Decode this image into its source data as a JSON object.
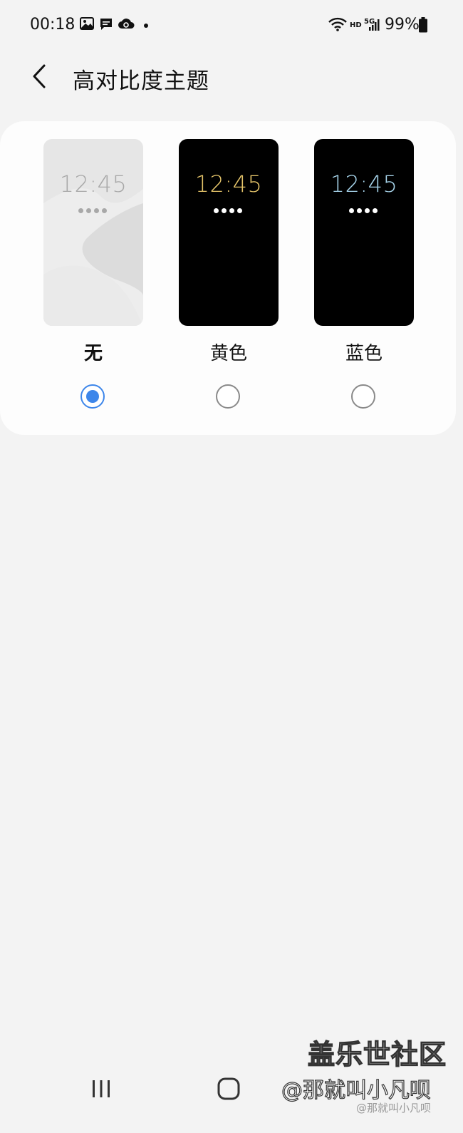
{
  "status_bar": {
    "time": "00:18",
    "battery": "99%",
    "hd_label": "HD",
    "network_label": "5G",
    "left_icons": [
      "image-icon",
      "message-icon",
      "cloud-sync-icon",
      "dot-icon"
    ],
    "right_icons": [
      "wifi-icon",
      "signal-icon",
      "battery-icon"
    ]
  },
  "header": {
    "title": "高对比度主题",
    "back_icon": "chevron-left-icon"
  },
  "themes": {
    "clock_text": "12:45",
    "options": [
      {
        "label": "无",
        "selected": true,
        "bg": "#e6e6e6",
        "clock_color": "#a8a8a8",
        "dot_color": "#a8a8a8"
      },
      {
        "label": "黄色",
        "selected": false,
        "bg": "#000000",
        "clock_color": "#e7c66b",
        "dot_color": "#ffffff"
      },
      {
        "label": "蓝色",
        "selected": false,
        "bg": "#000000",
        "clock_color": "#a9d7ee",
        "dot_color": "#ffffff"
      }
    ],
    "accent_color": "#3d86ea"
  },
  "watermark": {
    "main": "盖乐世社区",
    "handle": "@那就叫小凡呗",
    "sub": "@那就叫小凡呗"
  },
  "nav_bar": {
    "icons": [
      "recent-apps-icon",
      "home-icon",
      "back-icon"
    ]
  }
}
